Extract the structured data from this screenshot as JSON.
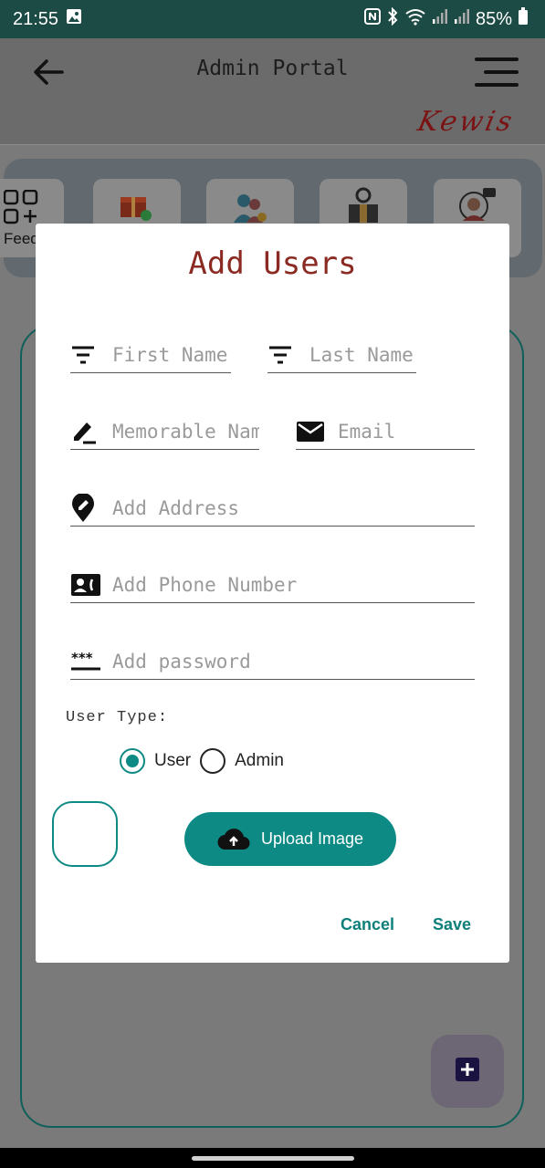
{
  "status_bar": {
    "time": "21:55",
    "battery": "85%"
  },
  "header": {
    "title": "Admin Portal",
    "brand": "Kewis"
  },
  "categories": {
    "first_label": "Feed"
  },
  "dialog": {
    "title": "Add Users",
    "fields": {
      "first_name": {
        "placeholder": "First Name",
        "value": ""
      },
      "last_name": {
        "placeholder": "Last Name",
        "value": ""
      },
      "memorable_name": {
        "placeholder": "Memorable Name",
        "value": ""
      },
      "email": {
        "placeholder": "Email",
        "value": ""
      },
      "address": {
        "placeholder": "Add Address",
        "value": ""
      },
      "phone": {
        "placeholder": "Add Phone Number",
        "value": ""
      },
      "password": {
        "placeholder": "Add password",
        "value": ""
      }
    },
    "user_type_label": "User Type:",
    "user_type_options": [
      "User",
      "Admin"
    ],
    "user_type_selected": "User",
    "upload_label": "Upload Image",
    "cancel_label": "Cancel",
    "save_label": "Save"
  },
  "colors": {
    "accent": "#0e8a84",
    "title": "#8a2a22",
    "status_bar": "#1c4a44"
  }
}
